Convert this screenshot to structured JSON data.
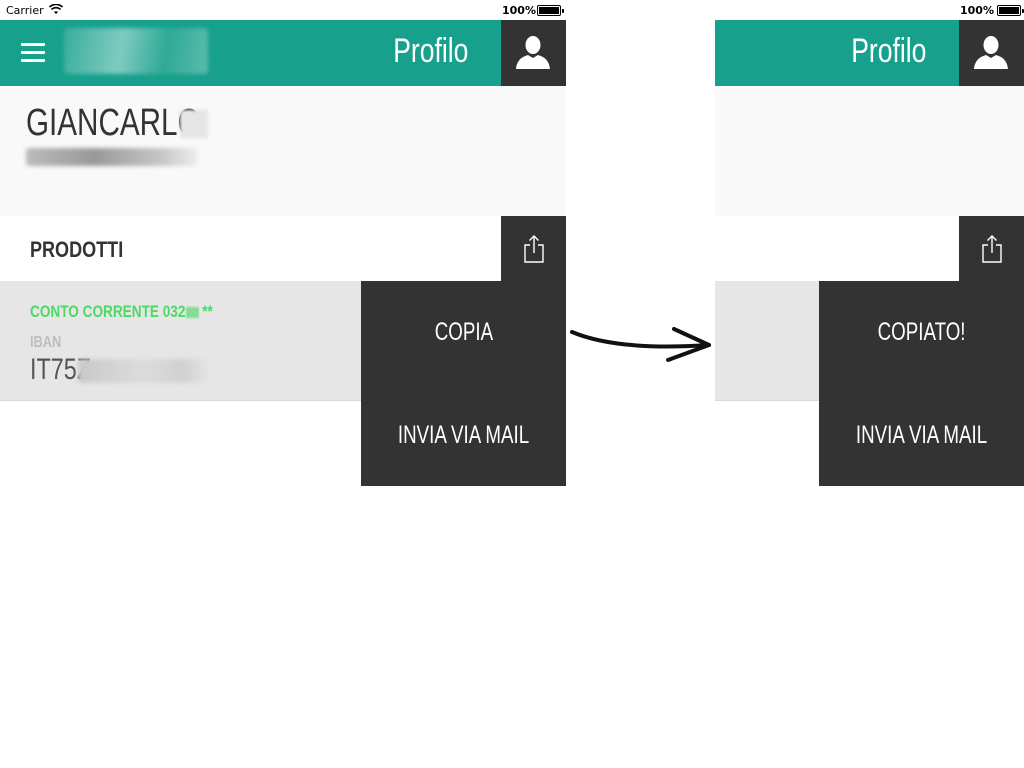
{
  "status_bar": {
    "carrier": "Carrier",
    "battery": "100%"
  },
  "navbar": {
    "title": "Profilo"
  },
  "profile": {
    "name": "GIANCARLO"
  },
  "products_section": {
    "title": "PRODOTTI"
  },
  "product": {
    "name_prefix": "CONTO CORRENTE 032",
    "name_suffix": "**",
    "iban_label": "IBAN",
    "iban_value": "IT75Z"
  },
  "actions_before": {
    "copy": "COPIA",
    "mail": "INVIA VIA MAIL"
  },
  "actions_after": {
    "copy": "COPIATO!",
    "mail": "INVIA VIA MAIL"
  },
  "colors": {
    "brand_teal": "#17a08c",
    "dark_panel": "#333333",
    "accent_green": "#4cd964"
  },
  "icons": {
    "menu": "hamburger-menu-icon",
    "avatar": "user-silhouette-icon",
    "share": "share-icon",
    "wifi": "wifi-icon",
    "battery": "battery-icon"
  }
}
